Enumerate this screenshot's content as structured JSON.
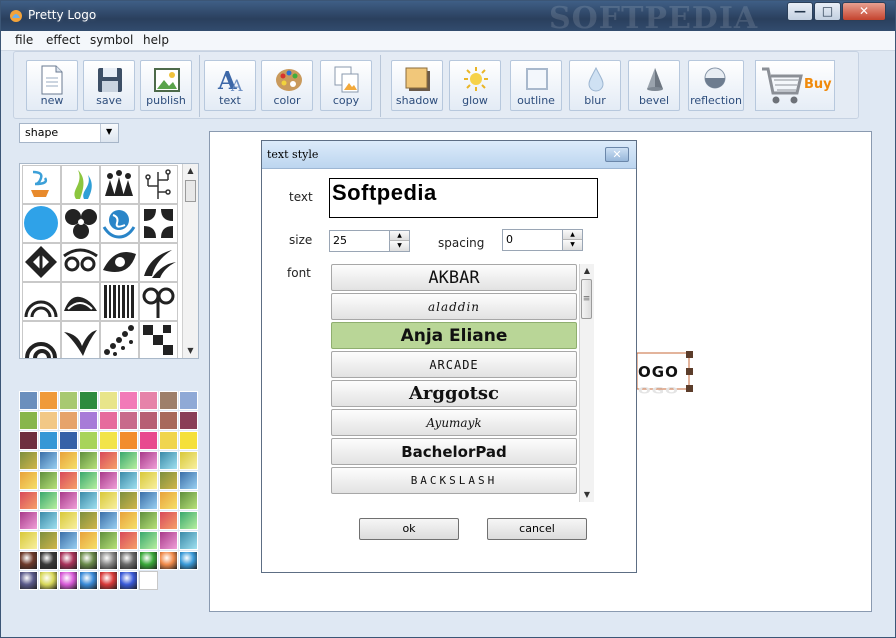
{
  "window": {
    "title": "Pretty Logo",
    "watermark": "SOFTPEDIA",
    "controls": {
      "minimize": "—",
      "maximize": "□",
      "close": "✕"
    }
  },
  "menu": [
    {
      "label": "file"
    },
    {
      "label": "effect"
    },
    {
      "label": "symbol"
    },
    {
      "label": "help"
    }
  ],
  "toolbar": {
    "new": "new",
    "save": "save",
    "publish": "publish",
    "text": "text",
    "color": "color",
    "copy": "copy",
    "shadow": "shadow",
    "glow": "glow",
    "outline": "outline",
    "blur": "blur",
    "bevel": "bevel",
    "reflection": "reflection",
    "buy": "Buy"
  },
  "shape_select": {
    "value": "shape"
  },
  "icons": {
    "dropdown": "▼",
    "scroll_up": "▲",
    "scroll_down": "▼",
    "grip": "≡"
  },
  "canvas": {
    "logo_text": "OGO"
  },
  "dialog": {
    "title": "text style",
    "close": "✕",
    "text_label": "text",
    "text_value": "Softpedia",
    "size_label": "size",
    "size_value": "25",
    "spacing_label": "spacing",
    "spacing_value": "0",
    "font_label": "font",
    "fonts": [
      "AKBAR",
      "aladdin",
      "Anja Eliane",
      "ARCADE",
      "Arggotsc",
      "Ayumayk",
      "BachelorPad",
      "BACKSLASH"
    ],
    "selected_font": "Anja Eliane",
    "ok": "ok",
    "cancel": "cancel"
  },
  "colors": {
    "accent": "#b9d697",
    "title_bar": "#2a3f5d",
    "buy": "#f08a0c"
  }
}
